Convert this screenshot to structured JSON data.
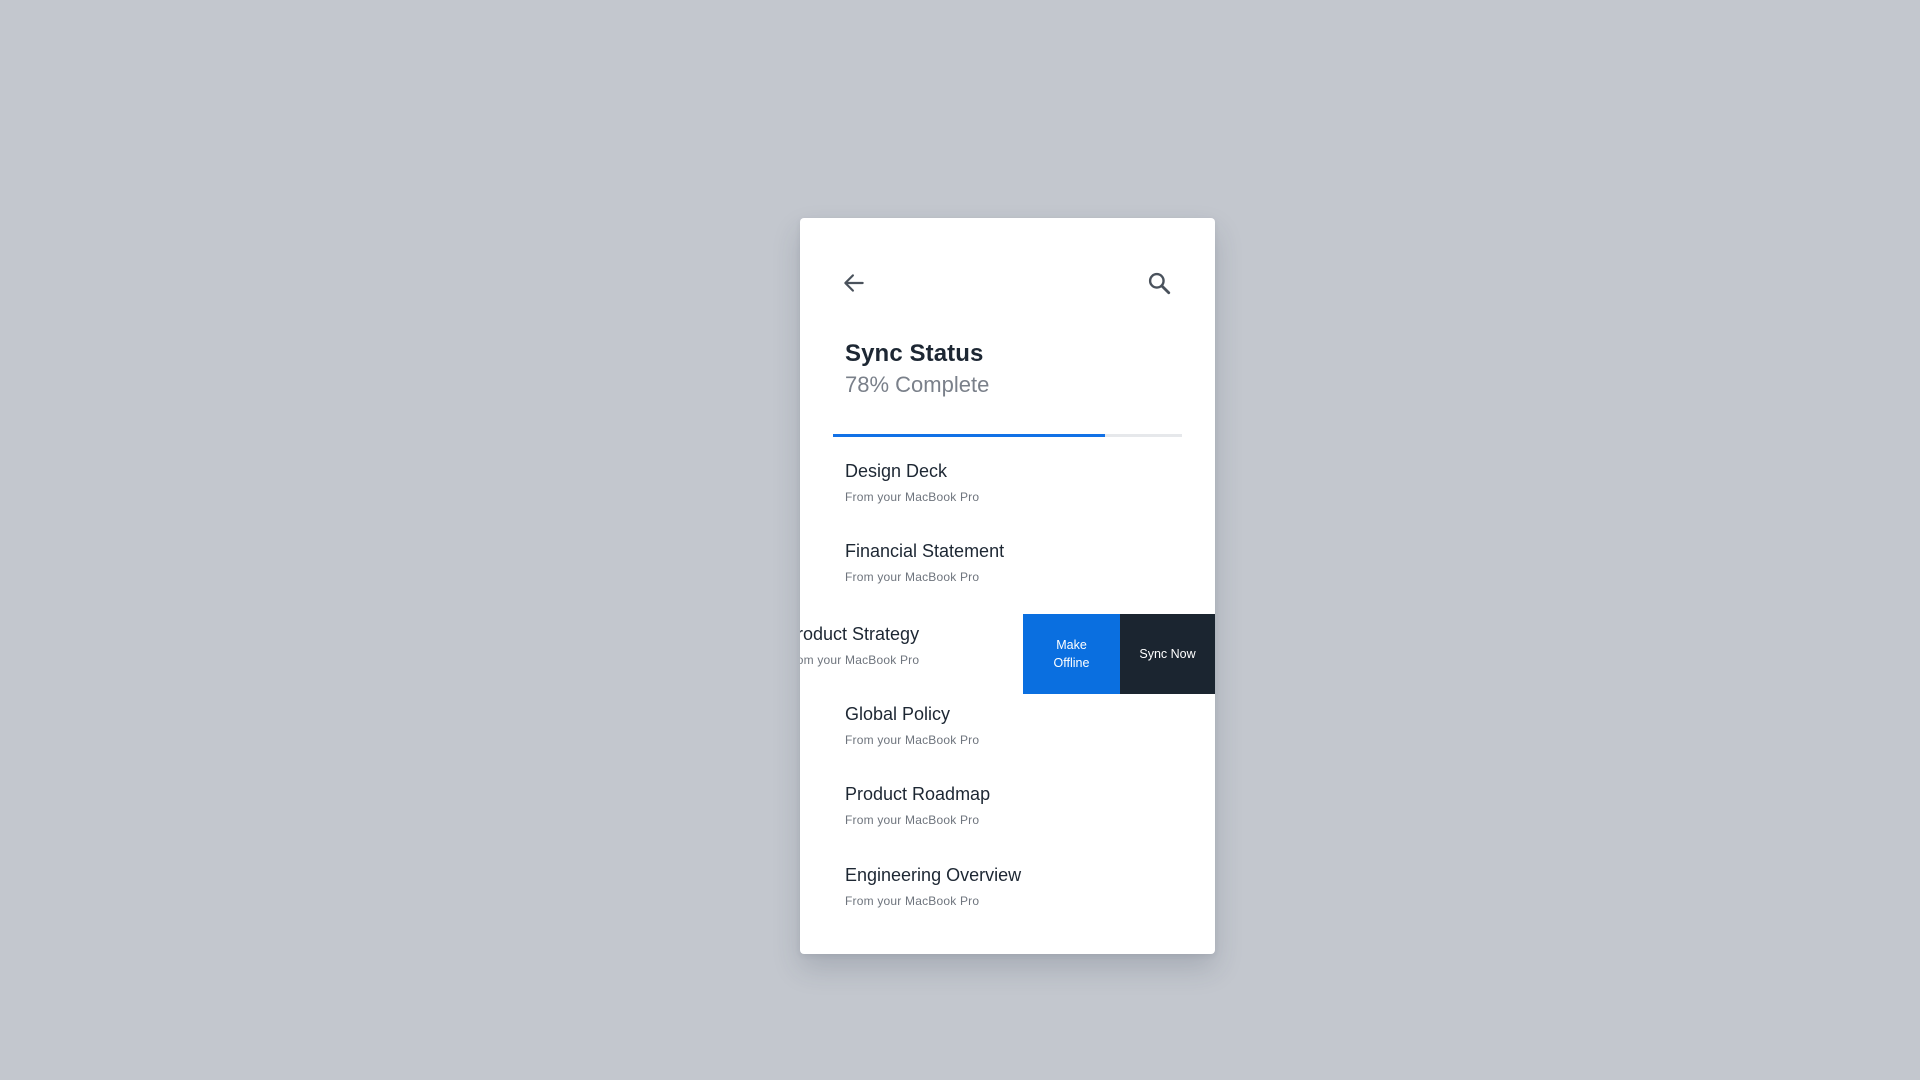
{
  "header": {
    "back_icon": "arrow-left-icon",
    "search_icon": "search-icon",
    "title": "Sync Status",
    "subtitle": "78% Complete"
  },
  "progress": {
    "fraction": 0.78,
    "fill_color": "#1271e6",
    "track_color": "#e6e8eb"
  },
  "files": [
    {
      "name": "Design Deck",
      "source": "From your MacBook Pro"
    },
    {
      "name": "Financial Statement",
      "source": "From your MacBook Pro"
    },
    {
      "name": "Product Strategy",
      "source": "From your MacBook Pro",
      "swiped": true
    },
    {
      "name": "Global Policy",
      "source": "From your MacBook Pro"
    },
    {
      "name": "Product Roadmap",
      "source": "From your MacBook Pro"
    },
    {
      "name": "Engineering Overview",
      "source": "From your MacBook Pro"
    }
  ],
  "swipe_actions": {
    "make_offline": "Make Offline",
    "sync_now": "Sync Now",
    "make_offline_color": "#0a6fe0",
    "sync_now_color": "#1b2530"
  },
  "colors": {
    "background": "#c3c7ce",
    "card": "#ffffff",
    "text_primary": "#1d2733",
    "text_secondary": "#7a808a"
  }
}
